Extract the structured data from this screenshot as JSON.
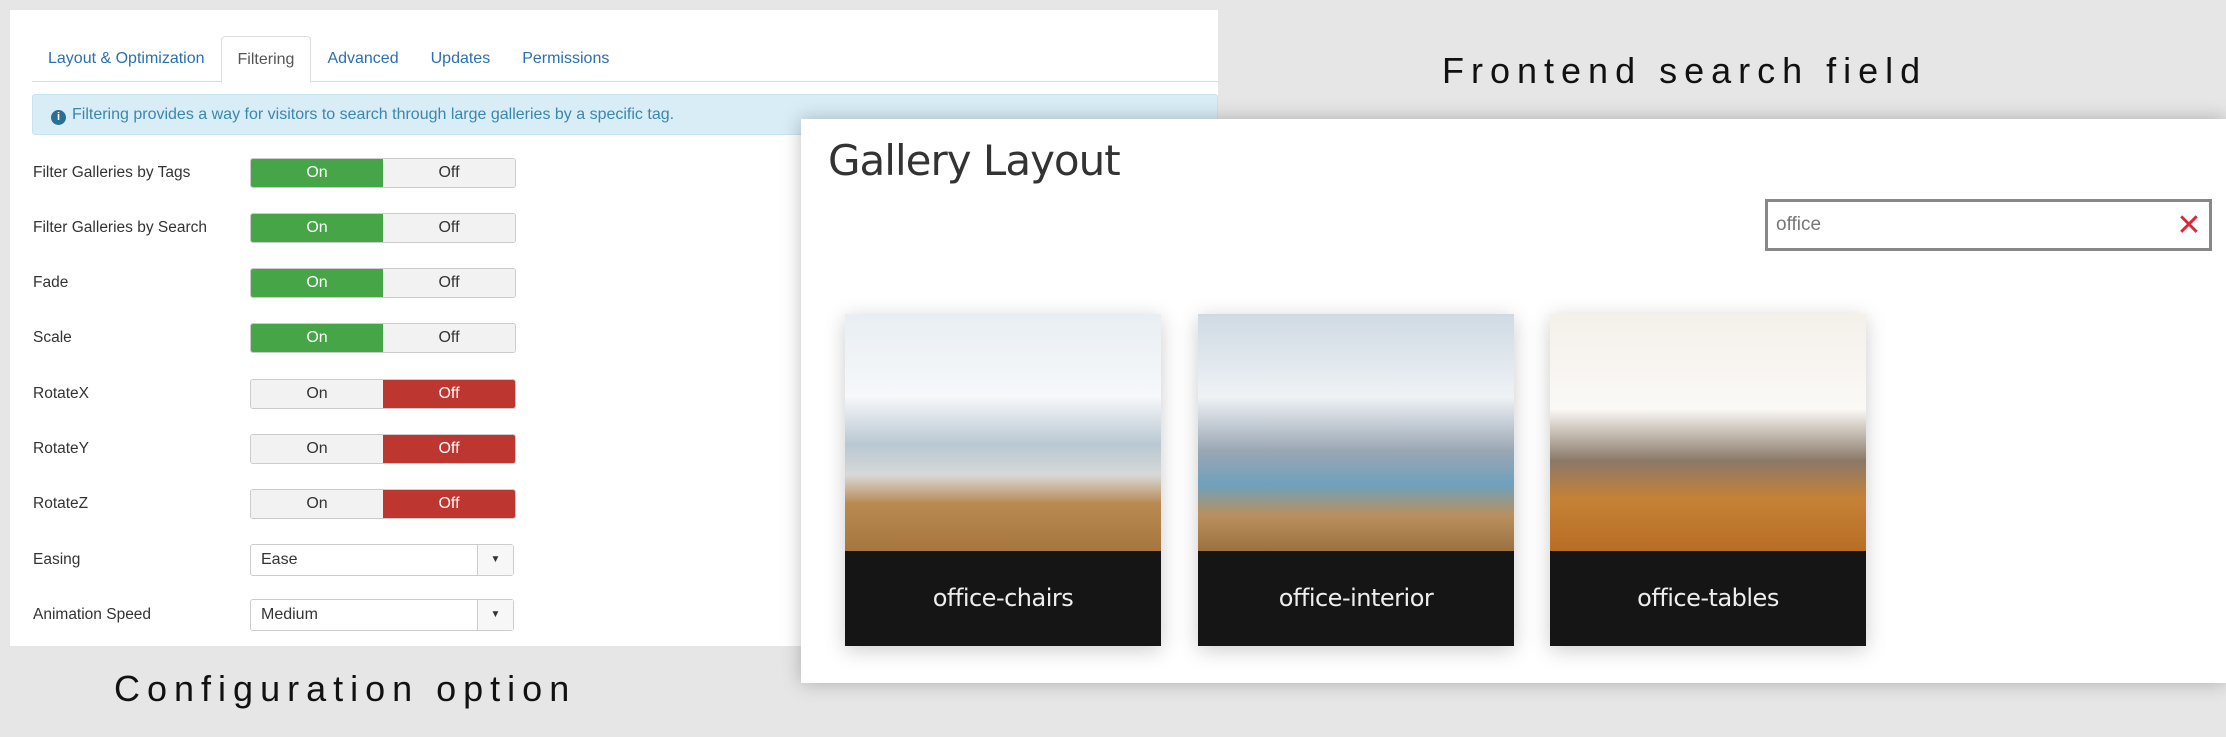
{
  "config": {
    "tabs": [
      {
        "label": "Layout & Optimization"
      },
      {
        "label": "Filtering",
        "active": true
      },
      {
        "label": "Advanced"
      },
      {
        "label": "Updates"
      },
      {
        "label": "Permissions"
      }
    ],
    "info": "Filtering provides a way for visitors to search through large galleries by a specific tag.",
    "info_icon": "info-circle-icon",
    "toggles": [
      {
        "label": "Filter Galleries by Tags",
        "value": "On"
      },
      {
        "label": "Filter Galleries by Search",
        "value": "On"
      },
      {
        "label": "Fade",
        "value": "On"
      },
      {
        "label": "Scale",
        "value": "On"
      },
      {
        "label": "RotateX",
        "value": "Off"
      },
      {
        "label": "RotateY",
        "value": "Off"
      },
      {
        "label": "RotateZ",
        "value": "Off"
      }
    ],
    "on_label": "On",
    "off_label": "Off",
    "selects": [
      {
        "label": "Easing",
        "value": "Ease"
      },
      {
        "label": "Animation Speed",
        "value": "Medium"
      }
    ],
    "colors": {
      "on": "#46a546",
      "off": "#bd362f",
      "link": "#2a6fb2"
    }
  },
  "gallery": {
    "title": "Gallery Layout",
    "search_value": "office",
    "clear_icon": "close-x-icon",
    "items": [
      {
        "caption": "office-chairs"
      },
      {
        "caption": "office-interior"
      },
      {
        "caption": "office-tables"
      }
    ]
  },
  "captions": {
    "frontend": "Frontend search field",
    "config": "Configuration option"
  }
}
